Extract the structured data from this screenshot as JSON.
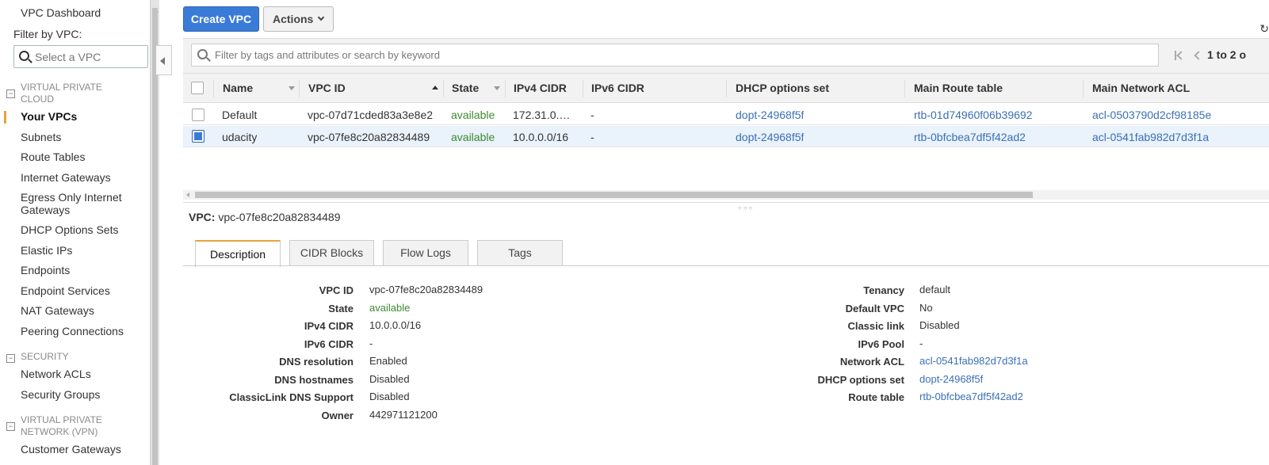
{
  "sidebar": {
    "dashboard": "VPC Dashboard",
    "filter_label": "Filter by VPC:",
    "filter_placeholder": "Select a VPC",
    "sections": {
      "vpc": {
        "line1": "VIRTUAL PRIVATE",
        "line2": "CLOUD"
      },
      "security": "SECURITY",
      "vpn": {
        "line1": "VIRTUAL PRIVATE",
        "line2": "NETWORK (VPN)"
      }
    },
    "items": {
      "your_vpcs": "Your VPCs",
      "subnets": "Subnets",
      "route_tables": "Route Tables",
      "internet_gateways": "Internet Gateways",
      "egress_1": "Egress Only Internet",
      "egress_2": "Gateways",
      "dhcp": "DHCP Options Sets",
      "elastic_ips": "Elastic IPs",
      "endpoints": "Endpoints",
      "endpoint_services": "Endpoint Services",
      "nat": "NAT Gateways",
      "peering": "Peering Connections",
      "network_acls": "Network ACLs",
      "security_groups": "Security Groups",
      "customer_gateways": "Customer Gateways"
    }
  },
  "toolbar": {
    "create_label": "Create VPC",
    "actions_label": "Actions",
    "search_placeholder": "Filter by tags and attributes or search by keyword",
    "pager_text": "1 to 2 o"
  },
  "table": {
    "headers": {
      "name": "Name",
      "vpc_id": "VPC ID",
      "state": "State",
      "ipv4": "IPv4 CIDR",
      "ipv6": "IPv6 CIDR",
      "dhcp": "DHCP options set",
      "route": "Main Route table",
      "acl": "Main Network ACL"
    },
    "rows": [
      {
        "name": "Default",
        "vpc_id": "vpc-07d71cded83a3e8e2",
        "state": "available",
        "ipv4": "172.31.0.…",
        "ipv6": "-",
        "dhcp": "dopt-24968f5f",
        "route": "rtb-01d74960f06b39692",
        "acl": "acl-0503790d2cf98185e"
      },
      {
        "name": "udacity",
        "vpc_id": "vpc-07fe8c20a82834489",
        "state": "available",
        "ipv4": "10.0.0.0/16",
        "ipv6": "-",
        "dhcp": "dopt-24968f5f",
        "route": "rtb-0bfcbea7df5f42ad2",
        "acl": "acl-0541fab982d7d3f1a"
      }
    ]
  },
  "detail": {
    "title_label": "VPC:",
    "title_value": "vpc-07fe8c20a82834489",
    "tabs": {
      "description": "Description",
      "cidr": "CIDR Blocks",
      "flow": "Flow Logs",
      "tags": "Tags"
    },
    "left": [
      {
        "label": "VPC ID",
        "value": "vpc-07fe8c20a82834489"
      },
      {
        "label": "State",
        "value": "available"
      },
      {
        "label": "IPv4 CIDR",
        "value": "10.0.0.0/16"
      },
      {
        "label": "IPv6 CIDR",
        "value": "-"
      },
      {
        "label": "DNS resolution",
        "value": "Enabled"
      },
      {
        "label": "DNS hostnames",
        "value": "Disabled"
      },
      {
        "label": "ClassicLink DNS Support",
        "value": "Disabled"
      },
      {
        "label": "Owner",
        "value": "442971121200"
      }
    ],
    "right": [
      {
        "label": "Tenancy",
        "value": "default"
      },
      {
        "label": "Default VPC",
        "value": "No"
      },
      {
        "label": "Classic link",
        "value": "Disabled"
      },
      {
        "label": "IPv6 Pool",
        "value": "-"
      },
      {
        "label": "Network ACL",
        "value": "acl-0541fab982d7d3f1a"
      },
      {
        "label": "DHCP options set",
        "value": "dopt-24968f5f"
      },
      {
        "label": "Route table",
        "value": "rtb-0bfcbea7df5f42ad2"
      }
    ]
  },
  "colors": {
    "primary": "#3b7bd8",
    "accent": "#e8a33d",
    "available": "#3c8a2e",
    "link": "#3b6fb6"
  }
}
